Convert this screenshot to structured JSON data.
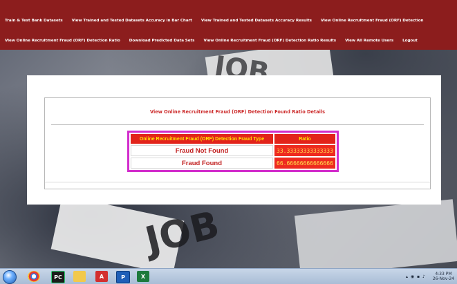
{
  "nav": {
    "row1": [
      "Train & Test Bank Datasets",
      "View Trained and Tested Datasets Accuracy in Bar Chart",
      "View Trained and Tested Datasets Accuracy Results",
      "View Online Recruitment Fraud (ORF) Detection"
    ],
    "row2": [
      "View Online Recruitment Fraud (ORF) Detection Ratio",
      "Download Predicted Data Sets",
      "View Online Recruitment Fraud (ORF) Detection Ratio Results",
      "View All Remote Users",
      "Logout"
    ]
  },
  "panel": {
    "title": "View Online Recruitment Fraud (ORF) Detection Found Ratio Details",
    "headers": [
      "Online Recruitment Fraud (ORF) Detection Fraud Type",
      "Ratio"
    ],
    "rows": [
      {
        "type": "Fraud Not Found",
        "ratio": "33.33333333333333"
      },
      {
        "type": "Fraud Found",
        "ratio": "66.66666666666666"
      }
    ]
  },
  "taskbar": {
    "icons": [
      "start-orb",
      "chrome-icon",
      "pycharm-icon",
      "file-explorer-icon",
      "acrobat-icon",
      "python-icon",
      "excel-icon"
    ],
    "time": "4:33 PM",
    "date": "26-Nov-24"
  },
  "colors": {
    "nav_bg": "#8c1d1d",
    "title_red": "#cc2a2a",
    "table_border": "#d22dcc",
    "header_bg": "#e2231a",
    "header_text": "#ffe600"
  }
}
